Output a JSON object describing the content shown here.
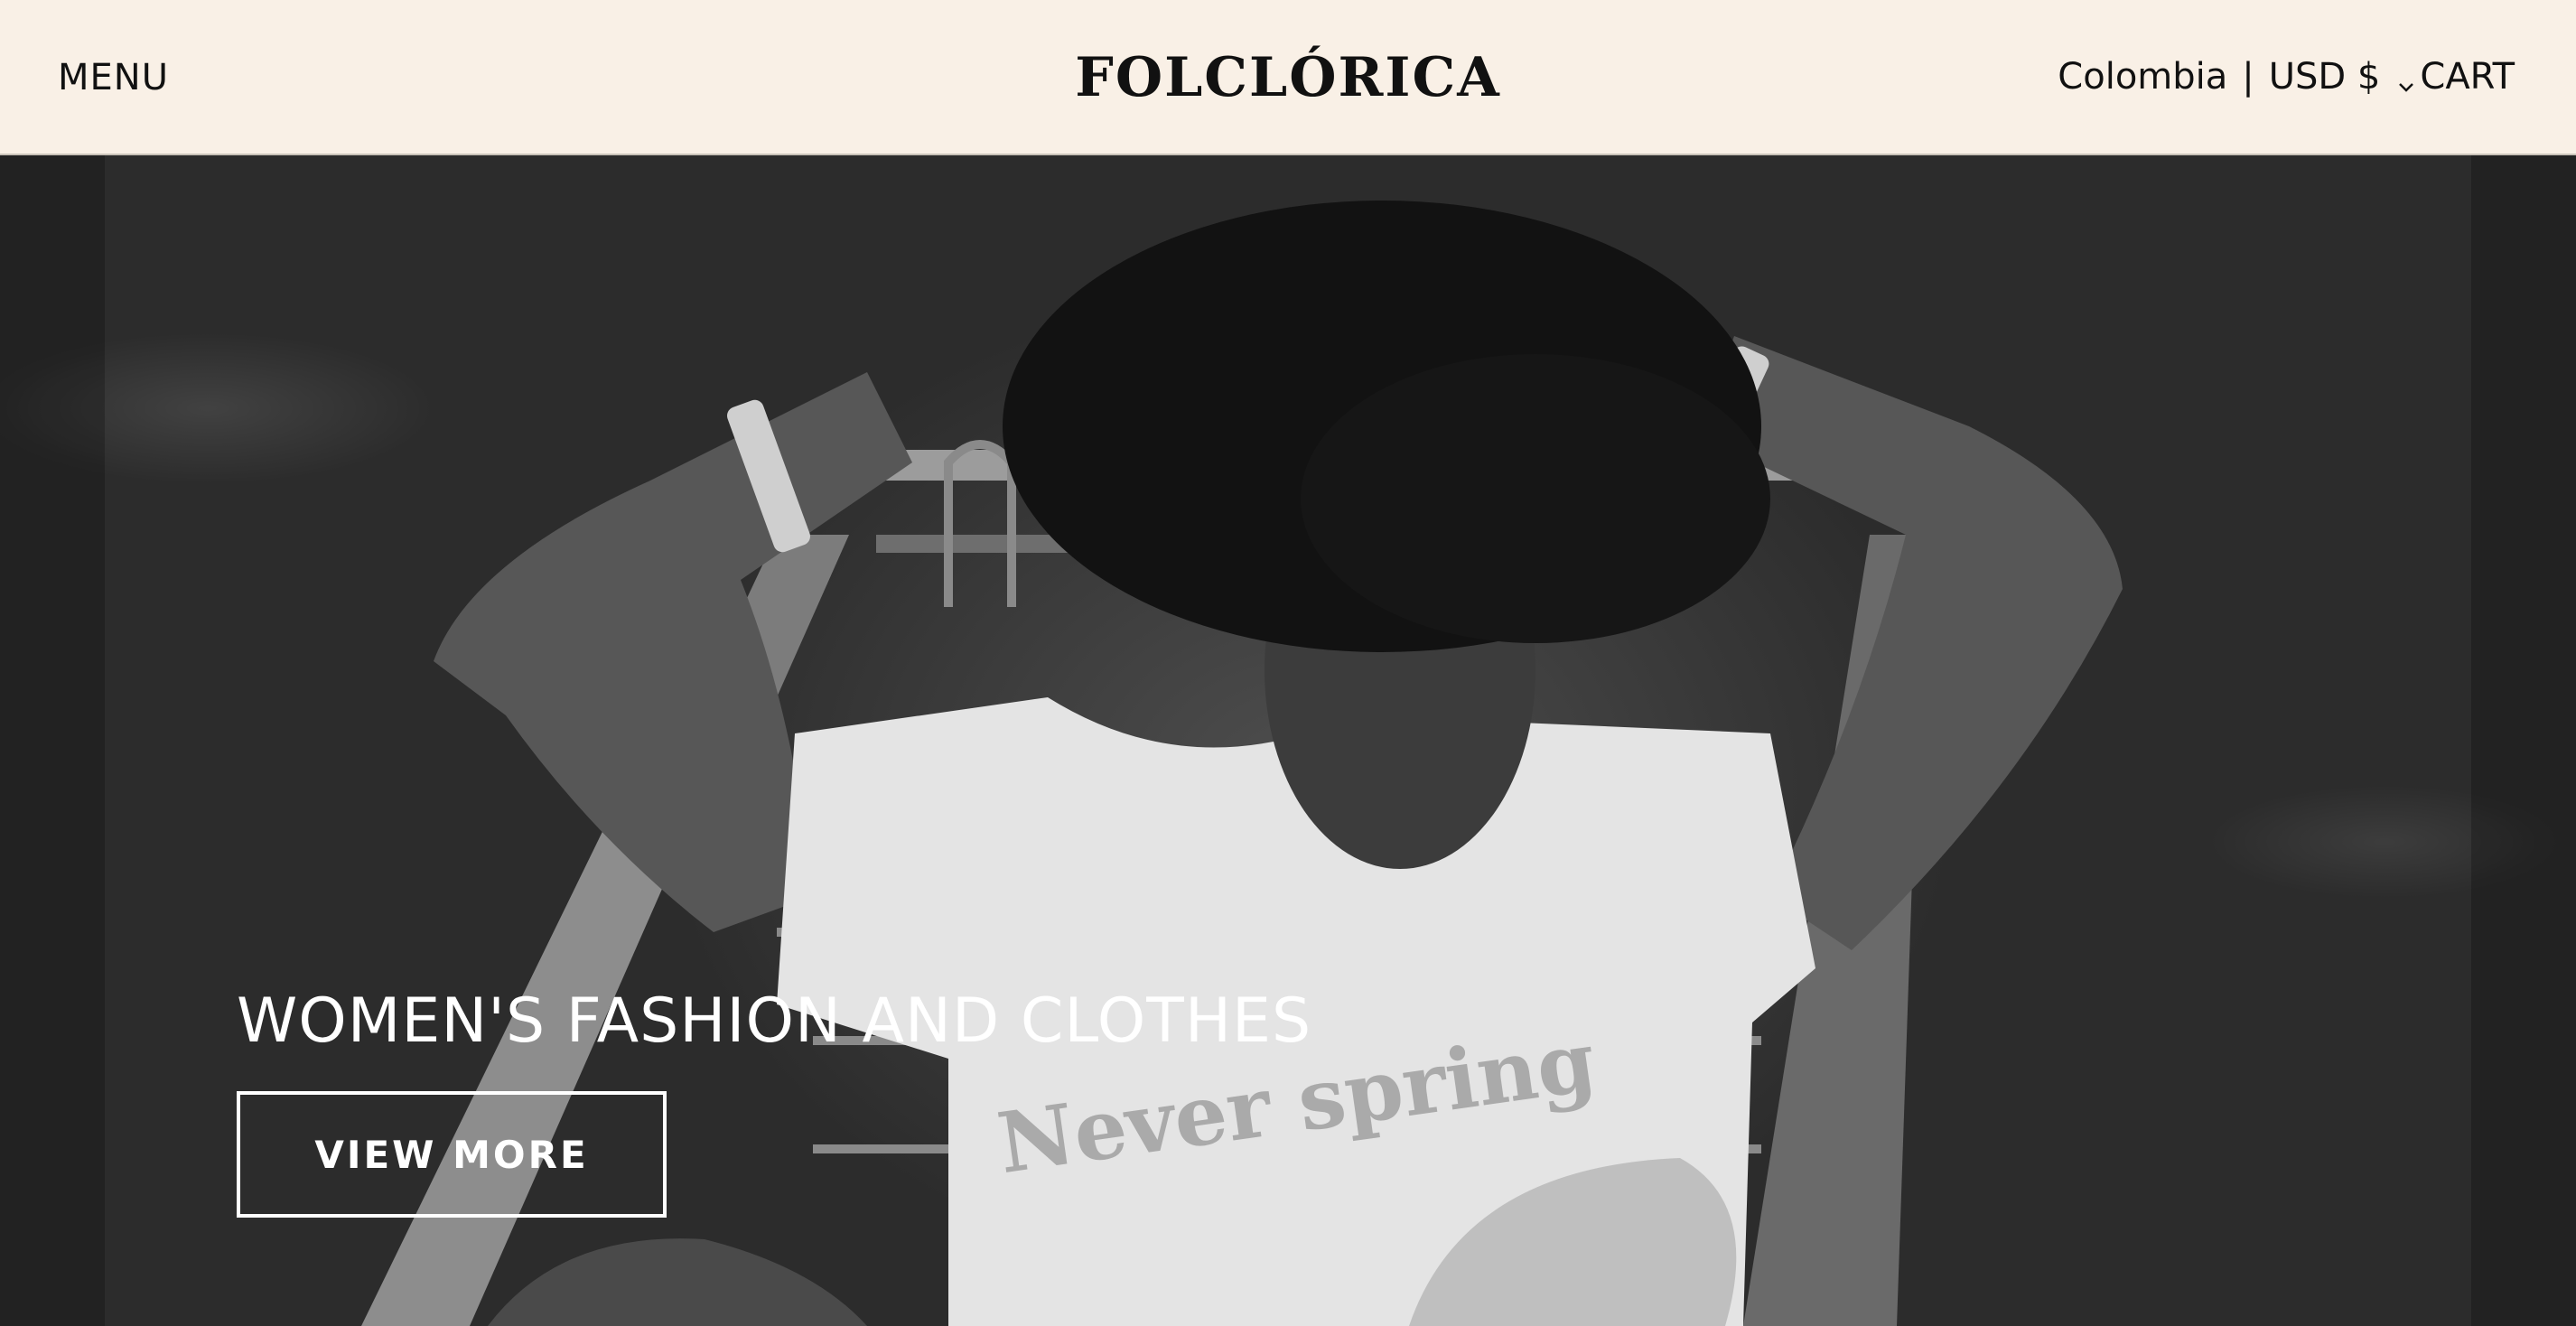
{
  "header": {
    "menu_label": "MENU",
    "logo_text": "FOLCLÓRICA",
    "country": "Colombia",
    "separator": "|",
    "currency": "USD $",
    "cart_label": "CART",
    "chevron_icon": "chevron-down-icon"
  },
  "hero": {
    "title": "WOMEN'S FASHION AND CLOTHES",
    "cta_label": "VIEW MORE",
    "image_desc": "black-and-white photo"
  },
  "colors": {
    "header_bg": "#f9f0e6",
    "text_dark": "#111111",
    "hero_text": "#ffffff"
  }
}
